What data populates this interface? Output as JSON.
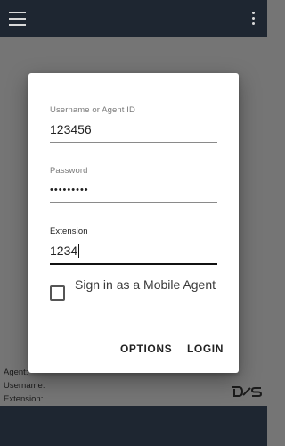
{
  "footer": {
    "agent_label": "Agent:",
    "username_label": "Username:",
    "extension_label": "Extension:"
  },
  "login_dialog": {
    "username": {
      "label": "Username or Agent ID",
      "value": "123456"
    },
    "password": {
      "label": "Password",
      "value": "•••••••••"
    },
    "extension": {
      "label": "Extension",
      "value": "1234"
    },
    "mobile_agent_label": "Sign in as a Mobile Agent",
    "mobile_agent_checked": false,
    "options_label": "OPTIONS",
    "login_label": "LOGIN"
  },
  "icons": [
    "menu-icon",
    "more-vert-icon"
  ],
  "colors": {
    "app_bar": "#1e2631",
    "scrim": "#757575",
    "dialog": "#ffffff"
  }
}
